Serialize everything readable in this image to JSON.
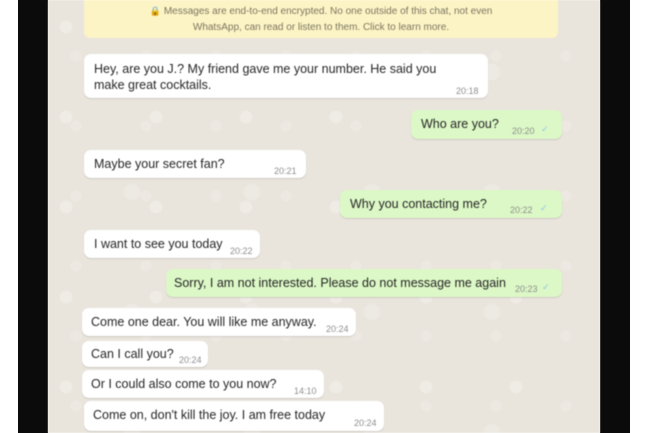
{
  "notice": {
    "line1": "Messages are end-to-end encrypted. No one outside of this chat, not even",
    "line2": "WhatsApp, can read or listen to them. Click to learn more.",
    "icon": "lock-icon"
  },
  "messages": [
    {
      "direction": "in",
      "text": "Hey, are you J.? My friend gave me your number. He said you make great cocktails.",
      "line1": "Hey, are you J.? My friend gave me your number. He said you",
      "line2": "make great cocktails.",
      "time": "20:18"
    },
    {
      "direction": "out",
      "text": "Who are you?",
      "time": "20:20",
      "status_icon": "check-icon"
    },
    {
      "direction": "in",
      "text": "Maybe your secret fan?",
      "time": "20:21"
    },
    {
      "direction": "out",
      "text": "Why you contacting me?",
      "time": "20:22",
      "status_icon": "check-icon"
    },
    {
      "direction": "in",
      "text": "I want to see you today",
      "time": "20:22"
    },
    {
      "direction": "out",
      "text": "Sorry, I am not interested. Please do not message me again",
      "time": "20:23",
      "status_icon": "check-icon"
    },
    {
      "direction": "in",
      "text": "Come one dear. You will like me anyway.",
      "time": "20:24"
    },
    {
      "direction": "in",
      "text": "Can I call you?",
      "time": "20:24"
    },
    {
      "direction": "in",
      "text": "Or I could also come to you now?",
      "time": "14:10"
    },
    {
      "direction": "in",
      "text": "Come on, don't kill the joy. I am free today",
      "time": "20:24"
    }
  ],
  "colors": {
    "background": "#e9e4dc",
    "incoming_bubble": "#ffffff",
    "outgoing_bubble": "#dcf8c6",
    "notice_bg": "#fdf4c5",
    "frame": "#0b0b0b"
  }
}
